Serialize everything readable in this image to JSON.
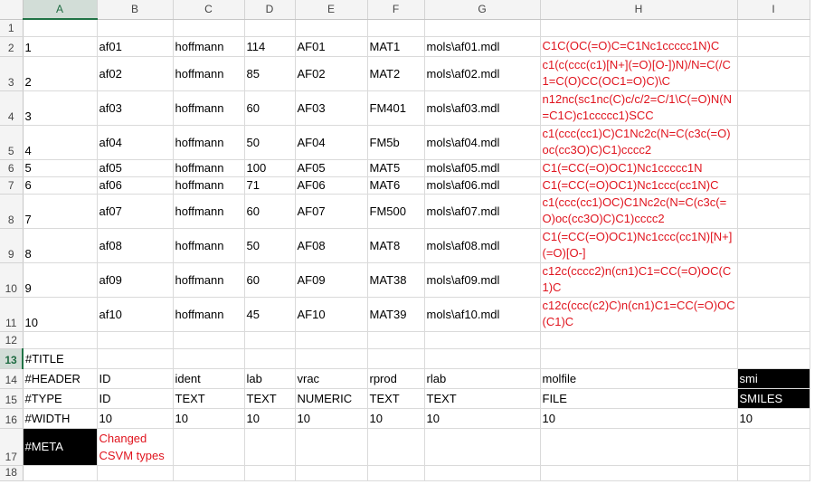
{
  "columns": [
    "A",
    "B",
    "C",
    "D",
    "E",
    "F",
    "G",
    "H",
    "I"
  ],
  "rows": [
    {
      "num": "1",
      "cells": [
        "",
        "",
        "",
        "",
        "",
        "",
        "",
        "",
        ""
      ]
    },
    {
      "num": "2",
      "cells": [
        "1",
        "af01",
        "hoffmann",
        "114",
        "AF01",
        "MAT1",
        "mols\\af01.mdl",
        "C1C(OC(=O)C=C1Nc1ccccc1N)C",
        ""
      ]
    },
    {
      "num": "3",
      "cells": [
        "2",
        "af02",
        "hoffmann",
        "85",
        "AF02",
        "MAT2",
        "mols\\af02.mdl",
        "c1(c(ccc(c1)[N+](=O)[O-])N)/N=C(/C1=C(O)CC(OC1=O)C)\\C",
        ""
      ]
    },
    {
      "num": "4",
      "cells": [
        "3",
        "af03",
        "hoffmann",
        "60",
        "AF03",
        "FM401",
        "mols\\af03.mdl",
        "n12nc(sc1nc(C)c/c/2=C/1\\C(=O)N(N=C1C)c1ccccc1)SCC",
        ""
      ]
    },
    {
      "num": "5",
      "cells": [
        "4",
        "af04",
        "hoffmann",
        "50",
        "AF04",
        "FM5b",
        "mols\\af04.mdl",
        "c1(ccc(cc1)C)C1Nc2c(N=C(c3c(=O)oc(cc3O)C)C1)cccc2",
        ""
      ]
    },
    {
      "num": "6",
      "cells": [
        "5",
        "af05",
        "hoffmann",
        "100",
        "AF05",
        "MAT5",
        "mols\\af05.mdl",
        "C1(=CC(=O)OC1)Nc1ccccc1N",
        ""
      ]
    },
    {
      "num": "7",
      "cells": [
        "6",
        "af06",
        "hoffmann",
        "71",
        "AF06",
        "MAT6",
        "mols\\af06.mdl",
        "C1(=CC(=O)OC1)Nc1ccc(cc1N)C",
        ""
      ]
    },
    {
      "num": "8",
      "cells": [
        "7",
        "af07",
        "hoffmann",
        "60",
        "AF07",
        "FM500",
        "mols\\af07.mdl",
        "c1(ccc(cc1)OC)C1Nc2c(N=C(c3c(=O)oc(cc3O)C)C1)cccc2",
        ""
      ]
    },
    {
      "num": "9",
      "cells": [
        "8",
        "af08",
        "hoffmann",
        "50",
        "AF08",
        "MAT8",
        "mols\\af08.mdl",
        "C1(=CC(=O)OC1)Nc1ccc(cc1N)[N+](=O)[O-]",
        ""
      ]
    },
    {
      "num": "10",
      "cells": [
        "9",
        "af09",
        "hoffmann",
        "60",
        "AF09",
        "MAT38",
        "mols\\af09.mdl",
        "c12c(cccc2)n(cn1)C1=CC(=O)OC(C1)C",
        ""
      ]
    },
    {
      "num": "11",
      "cells": [
        "10",
        "af10",
        "hoffmann",
        "45",
        "AF10",
        "MAT39",
        "mols\\af10.mdl",
        "c12c(ccc(c2)C)n(cn1)C1=CC(=O)OC(C1)C",
        ""
      ]
    },
    {
      "num": "12",
      "cells": [
        "",
        "",
        "",
        "",
        "",
        "",
        "",
        "",
        ""
      ]
    },
    {
      "num": "13",
      "cells": [
        "#TITLE",
        "",
        "",
        "",
        "",
        "",
        "",
        "",
        ""
      ]
    },
    {
      "num": "14",
      "cells": [
        "#HEADER",
        "ID",
        "ident",
        "lab",
        "vrac",
        "rprod",
        "rlab",
        "molfile",
        "smi"
      ]
    },
    {
      "num": "15",
      "cells": [
        "#TYPE",
        "ID",
        "TEXT",
        "TEXT",
        "NUMERIC",
        "TEXT",
        "TEXT",
        "FILE",
        "SMILES"
      ]
    },
    {
      "num": "16",
      "cells": [
        "#WIDTH",
        "10",
        "10",
        "10",
        "10",
        "10",
        "10",
        "10",
        "10"
      ]
    },
    {
      "num": "17",
      "cells": [
        "#META",
        "Changed CSVM types",
        "",
        "",
        "",
        "",
        "",
        "",
        ""
      ]
    },
    {
      "num": "18",
      "cells": [
        "",
        "",
        "",
        "",
        "",
        "",
        "",
        "",
        ""
      ]
    }
  ],
  "selected_column": "A",
  "selected_row": "13",
  "colors": {
    "smiles_text": "#e0141e",
    "note_text": "#e0141e",
    "header_selected": "#217346"
  }
}
